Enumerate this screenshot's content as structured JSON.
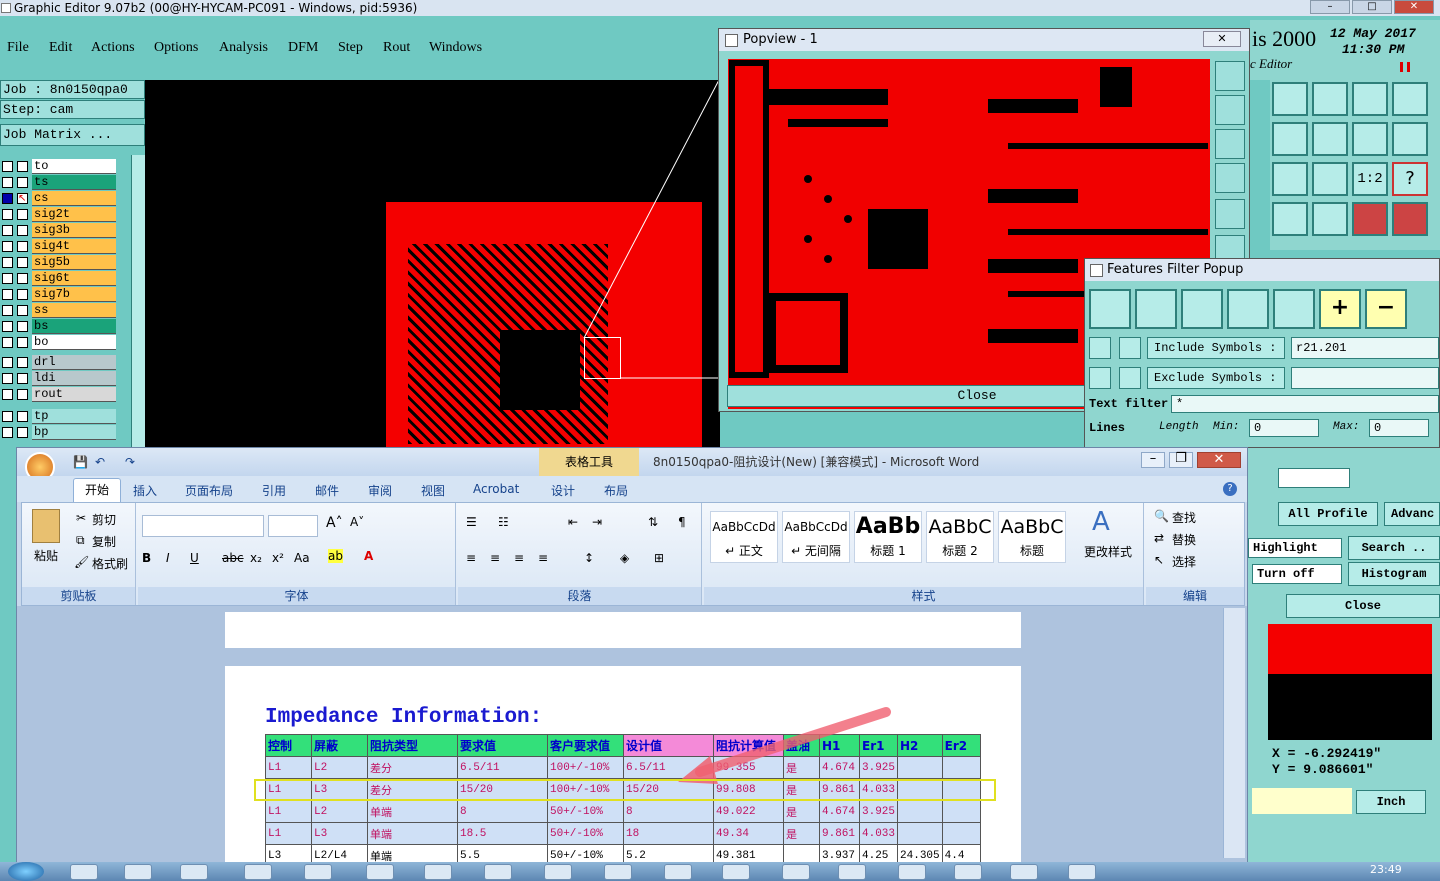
{
  "ge": {
    "window_title": "Graphic Editor 9.07b2 (00@HY-HYCAM-PC091 - Windows, pid:5936)",
    "menu": [
      "File",
      "Edit",
      "Actions",
      "Options",
      "Analysis",
      "DFM",
      "Step",
      "Rout",
      "Windows"
    ],
    "job_line": "Job : 8n0150qpa0",
    "step_line": "Step: cam",
    "job_matrix": "Job Matrix ...",
    "layers": [
      {
        "name": "to",
        "color": "#ffffff",
        "sel": false
      },
      {
        "name": "ts",
        "color": "#1aa37a",
        "sel": false
      },
      {
        "name": "cs",
        "color": "#ffc14a",
        "sel": true
      },
      {
        "name": "sig2t",
        "color": "#ffc14a",
        "sel": false
      },
      {
        "name": "sig3b",
        "color": "#ffc14a",
        "sel": false
      },
      {
        "name": "sig4t",
        "color": "#ffc14a",
        "sel": false
      },
      {
        "name": "sig5b",
        "color": "#ffc14a",
        "sel": false
      },
      {
        "name": "sig6t",
        "color": "#ffc14a",
        "sel": false
      },
      {
        "name": "sig7b",
        "color": "#ffc14a",
        "sel": false
      },
      {
        "name": "ss",
        "color": "#ffc14a",
        "sel": false
      },
      {
        "name": "bs",
        "color": "#1aa37a",
        "sel": false
      },
      {
        "name": "bo",
        "color": "#ffffff",
        "sel": false
      },
      {
        "name": "drl",
        "color": "#b8c8cc",
        "sel": false
      },
      {
        "name": "ldi",
        "color": "#b8c8cc",
        "sel": false
      },
      {
        "name": "rout",
        "color": "#d8d8d8",
        "sel": false
      },
      {
        "name": "tp",
        "color": "#9fe0dc",
        "sel": false
      },
      {
        "name": "bp",
        "color": "#9fe0dc",
        "sel": false
      }
    ],
    "brand_text": "is 2000",
    "date": "12 May 2017",
    "time": "11:30 PM",
    "editor_label": "c Editor"
  },
  "popview": {
    "title": "Popview - 1",
    "close": "Close"
  },
  "ffp": {
    "title": "Features Filter Popup",
    "include_label": "Include Symbols :",
    "include_value": "r21.201",
    "exclude_label": "Exclude Symbols :",
    "text_filter_label": "Text filter",
    "text_filter_value": "*",
    "lines_label": "Lines",
    "length_label": "Length",
    "min_label": "Min:",
    "max_label": "Max:",
    "min_value": "0",
    "max_value": "0"
  },
  "rpanel": {
    "all_profile": "All Profile",
    "advanced": "Advanc",
    "highlight": "Highlight",
    "search": "Search ..",
    "turn_off": "Turn off",
    "histogram": "Histogram",
    "close": "Close",
    "x_coord": "X = -6.292419\"",
    "y_coord": "Y = 9.086601\"",
    "units": "Inch"
  },
  "word": {
    "title": "8n0150qpa0-阻抗设计(New) [兼容模式] - Microsoft Word",
    "context_tab": "表格工具",
    "tabs": [
      "开始",
      "插入",
      "页面布局",
      "引用",
      "邮件",
      "审阅",
      "视图",
      "Acrobat",
      "设计",
      "布局"
    ],
    "clipboard": {
      "paste": "粘贴",
      "cut": "剪切",
      "copy": "复制",
      "format_painter": "格式刷",
      "label": "剪贴板"
    },
    "font_label": "字体",
    "paragraph_label": "段落",
    "styles": [
      {
        "sample": "AaBbCcDd",
        "name": "↵ 正文"
      },
      {
        "sample": "AaBbCcDd",
        "name": "↵ 无间隔"
      },
      {
        "sample": "AaBb",
        "name": "标题 1"
      },
      {
        "sample": "AaBbC",
        "name": "标题 2"
      },
      {
        "sample": "AaBbC",
        "name": "标题"
      }
    ],
    "change_styles": "更改样式",
    "styles_label": "样式",
    "edit": {
      "find": "查找",
      "replace": "替换",
      "select": "选择",
      "label": "编辑"
    },
    "doc_title": "Impedance Information:",
    "table_headers": [
      "控制",
      "屏蔽",
      "阻抗类型",
      "要求值",
      "客户要求值",
      "设计值",
      "阻抗计算值",
      "盖油",
      "H1",
      "Er1",
      "H2",
      "Er2"
    ],
    "table_rows": [
      [
        "L1",
        "L2",
        "差分",
        "6.5/11",
        "100+/-10%",
        "6.5/11",
        "99.355",
        "是",
        "4.674",
        "3.925",
        "",
        ""
      ],
      [
        "L1",
        "L3",
        "差分",
        "15/20",
        "100+/-10%",
        "15/20",
        "99.808",
        "是",
        "9.861",
        "4.033",
        "",
        ""
      ],
      [
        "L1",
        "L2",
        "单端",
        "8",
        "50+/-10%",
        "8",
        "49.022",
        "是",
        "4.674",
        "3.925",
        "",
        ""
      ],
      [
        "L1",
        "L3",
        "单端",
        "18.5",
        "50+/-10%",
        "18",
        "49.34",
        "是",
        "9.861",
        "4.033",
        "",
        ""
      ],
      [
        "L3",
        "L2/L4",
        "单端",
        "5.5",
        "50+/-10%",
        "5.2",
        "49.381",
        "",
        "3.937",
        "4.25",
        "24.305",
        "4.4"
      ]
    ]
  },
  "taskbar": {
    "clock": "23:49"
  }
}
